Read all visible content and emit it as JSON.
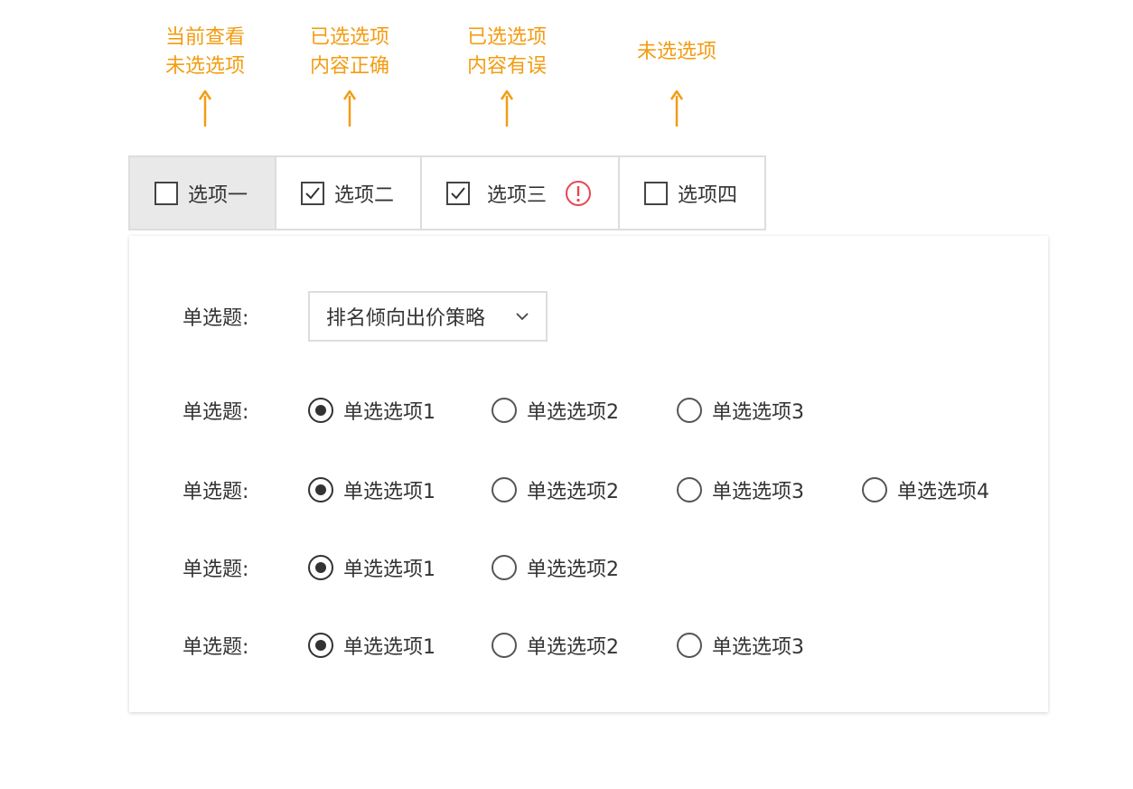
{
  "annotations": [
    {
      "line1": "当前查看",
      "line2": "未选选项"
    },
    {
      "line1": "已选选项",
      "line2": "内容正确"
    },
    {
      "line1": "已选选项",
      "line2": "内容有误"
    },
    {
      "line1": "未选选项",
      "line2": ""
    }
  ],
  "tabs": [
    {
      "label": "选项一",
      "checked": false,
      "active": true,
      "warning": false
    },
    {
      "label": "选项二",
      "checked": true,
      "active": false,
      "warning": false
    },
    {
      "label": "选项三",
      "checked": true,
      "active": false,
      "warning": true
    },
    {
      "label": "选项四",
      "checked": false,
      "active": false,
      "warning": false
    }
  ],
  "form": {
    "select_question": {
      "label": "单选题:",
      "value": "排名倾向出价策略"
    },
    "radio_questions": [
      {
        "label": "单选题:",
        "options": [
          "单选选项1",
          "单选选项2",
          "单选选项3"
        ],
        "selected": 0
      },
      {
        "label": "单选题:",
        "options": [
          "单选选项1",
          "单选选项2",
          "单选选项3",
          "单选选项4"
        ],
        "selected": 0
      },
      {
        "label": "单选题:",
        "options": [
          "单选选项1",
          "单选选项2"
        ],
        "selected": 0
      },
      {
        "label": "单选题:",
        "options": [
          "单选选项1",
          "单选选项2",
          "单选选项3"
        ],
        "selected": 0
      }
    ]
  },
  "colors": {
    "annotation": "#f39c12",
    "warning": "#e8474f",
    "active_tab": "#e9e9e9"
  }
}
